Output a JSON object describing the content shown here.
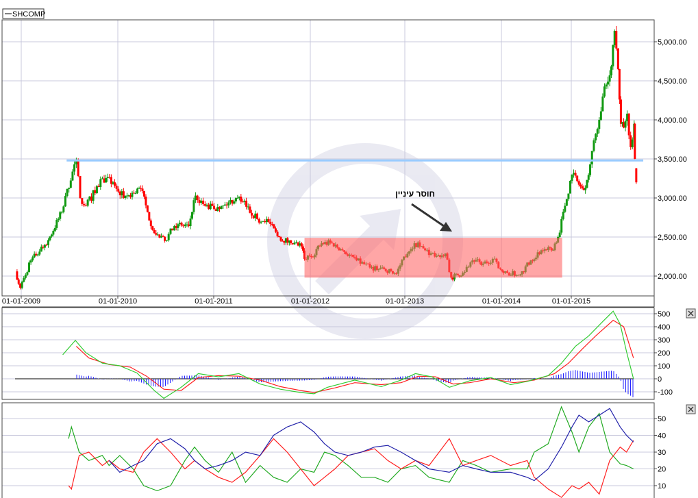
{
  "legend": {
    "symbol": "SHCOMP"
  },
  "annotation": {
    "text": "חוסר עיניין"
  },
  "colors": {
    "up": "#119911",
    "down": "#ff0000",
    "support_line": "#99ccff",
    "range_box": "#ff6666",
    "macd": "#33cc33",
    "signal": "#ff2020",
    "histogram": "#2222ff",
    "adx": "#2222aa",
    "plus_di": "#22aa22",
    "minus_di": "#ff2020"
  },
  "chart_data": [
    {
      "type": "candlestick",
      "title": "SHCOMP",
      "x_ticks": [
        {
          "t": 2009,
          "label": "01-01-2009"
        },
        {
          "t": 2010,
          "label": "01-01-2010"
        },
        {
          "t": 2011,
          "label": "01-01-2011"
        },
        {
          "t": 2012,
          "label": "01-01-2012"
        },
        {
          "t": 2013,
          "label": "01-01-2013"
        },
        {
          "t": 2014,
          "label": "01-01-2014"
        },
        {
          "t": 2015,
          "label": "01-01-2015"
        }
      ],
      "y_ticks": [
        "2,000.00",
        "2,500.00",
        "3,000.00",
        "3,500.00",
        "4,000.00",
        "4,500.00",
        "5,000.00"
      ],
      "y_tick_values": [
        2000,
        2500,
        3000,
        3500,
        4000,
        4500,
        5000
      ],
      "close_path": [
        [
          2008.94,
          2060
        ],
        [
          2008.99,
          1850
        ],
        [
          2009.1,
          2200
        ],
        [
          2009.28,
          2460
        ],
        [
          2009.42,
          2820
        ],
        [
          2009.55,
          3430
        ],
        [
          2009.57,
          3470
        ],
        [
          2009.61,
          3000
        ],
        [
          2009.67,
          2900
        ],
        [
          2009.84,
          3250
        ],
        [
          2009.95,
          3200
        ],
        [
          2010.06,
          3000
        ],
        [
          2010.24,
          3120
        ],
        [
          2010.31,
          2820
        ],
        [
          2010.38,
          2550
        ],
        [
          2010.49,
          2450
        ],
        [
          2010.59,
          2640
        ],
        [
          2010.74,
          2640
        ],
        [
          2010.81,
          3030
        ],
        [
          2010.91,
          2900
        ],
        [
          2011.06,
          2860
        ],
        [
          2011.23,
          3000
        ],
        [
          2011.3,
          2950
        ],
        [
          2011.45,
          2730
        ],
        [
          2011.55,
          2730
        ],
        [
          2011.66,
          2510
        ],
        [
          2011.8,
          2420
        ],
        [
          2011.91,
          2380
        ],
        [
          2011.94,
          2220
        ],
        [
          2012.01,
          2250
        ],
        [
          2012.12,
          2420
        ],
        [
          2012.23,
          2420
        ],
        [
          2012.34,
          2330
        ],
        [
          2012.49,
          2200
        ],
        [
          2012.63,
          2110
        ],
        [
          2012.78,
          2090
        ],
        [
          2012.91,
          2030
        ],
        [
          2012.99,
          2250
        ],
        [
          2013.1,
          2420
        ],
        [
          2013.21,
          2330
        ],
        [
          2013.31,
          2250
        ],
        [
          2013.42,
          2290
        ],
        [
          2013.48,
          1980
        ],
        [
          2013.6,
          2040
        ],
        [
          2013.7,
          2200
        ],
        [
          2013.81,
          2160
        ],
        [
          2013.91,
          2220
        ],
        [
          2014.03,
          2040
        ],
        [
          2014.27,
          2020
        ],
        [
          2014.42,
          2200
        ],
        [
          2014.57,
          2330
        ],
        [
          2014.72,
          2330
        ],
        [
          2014.81,
          2500
        ],
        [
          2014.91,
          2900
        ],
        [
          2015.01,
          3300
        ],
        [
          2015.11,
          3170
        ],
        [
          2015.18,
          3100
        ],
        [
          2015.27,
          3430
        ],
        [
          2015.35,
          3820
        ],
        [
          2015.45,
          4300
        ],
        [
          2015.55,
          4570
        ],
        [
          2015.62,
          5140
        ],
        [
          2015.67,
          4650
        ],
        [
          2015.71,
          3950
        ],
        [
          2015.75,
          3900
        ],
        [
          2015.8,
          4080
        ],
        [
          2015.85,
          3650
        ],
        [
          2015.9,
          3950
        ],
        [
          2015.91,
          3500
        ],
        [
          2015.93,
          3200
        ]
      ],
      "support_level": 3480,
      "support_range": [
        2009.47,
        2016.03
      ],
      "range_box": {
        "t_start": 2011.94,
        "t_end": 2014.87,
        "low": 1980,
        "high": 2490
      },
      "ylim": [
        1700,
        5300
      ]
    },
    {
      "type": "line",
      "title": "MACD",
      "y_ticks": [
        "-100",
        "0",
        "100",
        "200",
        "300",
        "400",
        "500"
      ],
      "y_tick_values": [
        -100,
        0,
        100,
        200,
        300,
        400,
        500
      ],
      "ylim": [
        -150,
        540
      ],
      "series": [
        {
          "name": "macd",
          "points": [
            [
              2009.43,
              185
            ],
            [
              2009.56,
              295
            ],
            [
              2009.67,
              200
            ],
            [
              2009.84,
              120
            ],
            [
              2010.02,
              100
            ],
            [
              2010.2,
              45
            ],
            [
              2010.38,
              -90
            ],
            [
              2010.48,
              -150
            ],
            [
              2010.66,
              -65
            ],
            [
              2010.84,
              40
            ],
            [
              2011.05,
              15
            ],
            [
              2011.26,
              40
            ],
            [
              2011.48,
              -40
            ],
            [
              2011.69,
              -80
            ],
            [
              2011.9,
              -105
            ],
            [
              2012.04,
              -115
            ],
            [
              2012.18,
              -65
            ],
            [
              2012.47,
              -10
            ],
            [
              2012.75,
              -60
            ],
            [
              2012.96,
              -10
            ],
            [
              2013.11,
              40
            ],
            [
              2013.28,
              15
            ],
            [
              2013.46,
              -65
            ],
            [
              2013.67,
              -15
            ],
            [
              2013.89,
              10
            ],
            [
              2014.13,
              -45
            ],
            [
              2014.37,
              -20
            ],
            [
              2014.67,
              25
            ],
            [
              2014.86,
              120
            ],
            [
              2015.06,
              250
            ],
            [
              2015.25,
              330
            ],
            [
              2015.45,
              440
            ],
            [
              2015.6,
              520
            ],
            [
              2015.7,
              420
            ],
            [
              2015.79,
              210
            ],
            [
              2015.89,
              0
            ]
          ]
        },
        {
          "name": "signal",
          "points": [
            [
              2009.57,
              250
            ],
            [
              2009.7,
              160
            ],
            [
              2009.91,
              110
            ],
            [
              2010.13,
              90
            ],
            [
              2010.3,
              20
            ],
            [
              2010.48,
              -80
            ],
            [
              2010.66,
              -90
            ],
            [
              2010.84,
              10
            ],
            [
              2011.05,
              25
            ],
            [
              2011.26,
              20
            ],
            [
              2011.48,
              -10
            ],
            [
              2011.69,
              -60
            ],
            [
              2011.9,
              -90
            ],
            [
              2012.04,
              -105
            ],
            [
              2012.26,
              -70
            ],
            [
              2012.47,
              -30
            ],
            [
              2012.75,
              -45
            ],
            [
              2012.96,
              -30
            ],
            [
              2013.14,
              20
            ],
            [
              2013.32,
              15
            ],
            [
              2013.5,
              -40
            ],
            [
              2013.67,
              -30
            ],
            [
              2013.89,
              0
            ],
            [
              2014.18,
              -30
            ],
            [
              2014.47,
              -10
            ],
            [
              2014.76,
              40
            ],
            [
              2014.96,
              120
            ],
            [
              2015.16,
              230
            ],
            [
              2015.35,
              330
            ],
            [
              2015.6,
              450
            ],
            [
              2015.75,
              400
            ],
            [
              2015.89,
              160
            ]
          ]
        }
      ]
    },
    {
      "type": "line",
      "title": "DMI",
      "y_ticks": [
        "10",
        "20",
        "30",
        "40",
        "50"
      ],
      "y_tick_values": [
        10,
        20,
        30,
        40,
        50
      ],
      "ylim": [
        2,
        60
      ],
      "t": [
        2009.49,
        2009.52,
        2009.6,
        2009.7,
        2009.84,
        2009.91,
        2010.02,
        2010.16,
        2010.27,
        2010.41,
        2010.55,
        2010.7,
        2010.8,
        2010.91,
        2011.05,
        2011.19,
        2011.33,
        2011.48,
        2011.62,
        2011.76,
        2011.9,
        2012.04,
        2012.15,
        2012.26,
        2012.4,
        2012.54,
        2012.68,
        2012.82,
        2012.96,
        2013.11,
        2013.25,
        2013.46,
        2013.6,
        2013.74,
        2013.89,
        2014.13,
        2014.37,
        2014.47,
        2014.67,
        2014.86,
        2015.01,
        2015.11,
        2015.25,
        2015.4,
        2015.55,
        2015.7,
        2015.79,
        2015.89
      ],
      "series": [
        {
          "name": "plus_di",
          "values": [
            38,
            45,
            30,
            25,
            28,
            22,
            28,
            20,
            10,
            7,
            10,
            25,
            33,
            25,
            18,
            30,
            12,
            22,
            15,
            12,
            20,
            18,
            30,
            28,
            22,
            15,
            15,
            12,
            20,
            22,
            15,
            12,
            25,
            22,
            18,
            20,
            20,
            30,
            35,
            57,
            42,
            30,
            45,
            53,
            30,
            23,
            22,
            20
          ]
        },
        {
          "name": "minus_di",
          "values": [
            10,
            8,
            28,
            30,
            22,
            25,
            20,
            18,
            30,
            38,
            30,
            20,
            25,
            20,
            15,
            12,
            18,
            28,
            38,
            30,
            20,
            10,
            15,
            20,
            28,
            30,
            32,
            25,
            20,
            25,
            22,
            38,
            22,
            25,
            28,
            22,
            25,
            15,
            8,
            3,
            10,
            8,
            12,
            5,
            25,
            33,
            30,
            37
          ]
        },
        {
          "name": "adx",
          "values": [
            null,
            null,
            null,
            null,
            null,
            25,
            18,
            22,
            25,
            35,
            38,
            32,
            25,
            20,
            22,
            25,
            30,
            28,
            40,
            45,
            48,
            42,
            35,
            30,
            28,
            30,
            33,
            34,
            30,
            25,
            20,
            18,
            22,
            20,
            18,
            18,
            15,
            13,
            20,
            33,
            45,
            52,
            48,
            52,
            56,
            45,
            40,
            36
          ]
        }
      ]
    }
  ]
}
